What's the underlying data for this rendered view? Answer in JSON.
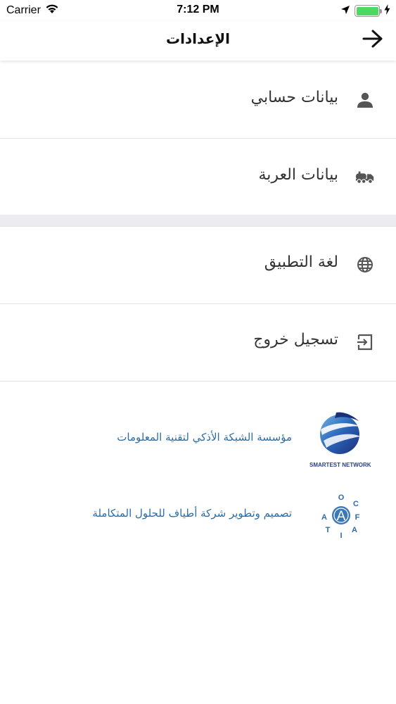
{
  "status_bar": {
    "carrier": "Carrier",
    "time": "7:12 PM",
    "battery_level": 1.0,
    "battery_color": "#4cd964"
  },
  "nav": {
    "title": "الإعدادات",
    "back_icon": "arrow-right-icon"
  },
  "menu": {
    "group1": [
      {
        "label": "بيانات حسابي",
        "icon": "person-icon"
      },
      {
        "label": "بيانات العربة",
        "icon": "truck-icon"
      }
    ],
    "group2": [
      {
        "label": "لغة التطبيق",
        "icon": "globe-icon"
      },
      {
        "label": "تسجيل خروج",
        "icon": "logout-icon"
      }
    ]
  },
  "credits": [
    {
      "text": "مؤسسة الشبكة الأذكي لتقنية المعلومات",
      "logo": "smartest-network-logo",
      "logo_caption": "SMARTEST NETWORK"
    },
    {
      "text": "تصميم وتطوير شركة أطياف للحلول المتكاملة",
      "logo": "atyaf-logo",
      "logo_letters": [
        "A",
        "O",
        "C",
        "T",
        "I",
        "A",
        "F",
        "A"
      ]
    }
  ],
  "colors": {
    "link": "#2b6ea5",
    "separator": "#ebebf0",
    "icon": "#555555"
  }
}
